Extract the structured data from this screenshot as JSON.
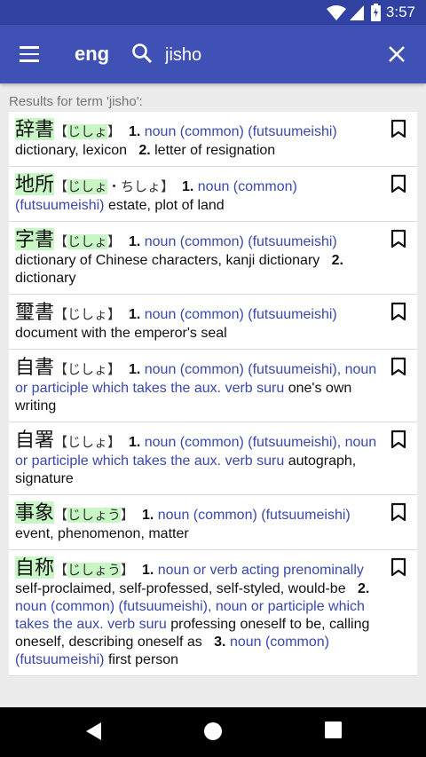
{
  "status": {
    "time": "3:57",
    "battery_level": 0.7
  },
  "appbar": {
    "lang": "eng",
    "query": "jisho",
    "menu_icon": "hamburger-menu-icon",
    "search_icon": "search-icon",
    "close_icon": "close-icon"
  },
  "results_label": "Results for term 'jisho':",
  "entries": [
    {
      "kanji": "辞書",
      "reading": "じしょ",
      "kanji_hl": true,
      "reading_hl": true,
      "reading_extra": "",
      "senses": [
        {
          "num": "1.",
          "pos": "noun (common) (futsuumeishi)",
          "gloss": "dictionary, lexicon"
        },
        {
          "num": "2.",
          "pos": "",
          "gloss": "letter of resignation"
        }
      ]
    },
    {
      "kanji": "地所",
      "reading": "じしょ",
      "kanji_hl": true,
      "reading_hl": true,
      "reading_extra": "・ちしょ",
      "senses": [
        {
          "num": "1.",
          "pos": "noun (common) (futsuumeishi)",
          "gloss": "estate, plot of land"
        }
      ]
    },
    {
      "kanji": "字書",
      "reading": "じしょ",
      "kanji_hl": true,
      "reading_hl": true,
      "reading_extra": "",
      "senses": [
        {
          "num": "1.",
          "pos": "noun (common) (futsuumeishi)",
          "gloss": "dictionary of Chinese characters, kanji dictionary"
        },
        {
          "num": "2.",
          "pos": "",
          "gloss": "dictionary"
        }
      ]
    },
    {
      "kanji": "璽書",
      "reading": "じしょ",
      "kanji_hl": false,
      "reading_hl": false,
      "reading_extra": "",
      "senses": [
        {
          "num": "1.",
          "pos": "noun (common) (futsuumeishi)",
          "gloss": "document with the emperor's seal"
        }
      ]
    },
    {
      "kanji": "自書",
      "reading": "じしょ",
      "kanji_hl": false,
      "reading_hl": false,
      "reading_extra": "",
      "senses": [
        {
          "num": "1.",
          "pos": "noun (common) (futsuumeishi), noun or participle which takes the aux. verb suru",
          "gloss": "one's own writing"
        }
      ]
    },
    {
      "kanji": "自署",
      "reading": "じしょ",
      "kanji_hl": false,
      "reading_hl": false,
      "reading_extra": "",
      "senses": [
        {
          "num": "1.",
          "pos": "noun (common) (futsuumeishi), noun or participle which takes the aux. verb suru",
          "gloss": "autograph, signature"
        }
      ]
    },
    {
      "kanji": "事象",
      "reading": "じしょう",
      "kanji_hl": true,
      "reading_hl": true,
      "reading_extra": "",
      "senses": [
        {
          "num": "1.",
          "pos": "noun (common) (futsuumeishi)",
          "gloss": "event, phenomenon, matter"
        }
      ]
    },
    {
      "kanji": "自称",
      "reading": "じしょう",
      "kanji_hl": true,
      "reading_hl": true,
      "reading_extra": "",
      "senses": [
        {
          "num": "1.",
          "pos": "noun or verb acting prenominally",
          "gloss": "self-proclaimed, self-professed, self-styled, would-be"
        },
        {
          "num": "2.",
          "pos": "noun (common) (futsuumeishi), noun or participle which takes the aux. verb suru",
          "gloss": "professing oneself to be, calling oneself, describing oneself as"
        },
        {
          "num": "3.",
          "pos": "noun (common) (futsuumeishi)",
          "gloss": "first person"
        }
      ]
    }
  ],
  "colors": {
    "appbar": "#3f51b5",
    "statusbar": "#3141a1",
    "pos": "#3949ab",
    "highlight": "#c8f7c5"
  },
  "navbar": {
    "back": "back-triangle-icon",
    "home": "home-circle-icon",
    "recents": "recents-square-icon"
  }
}
